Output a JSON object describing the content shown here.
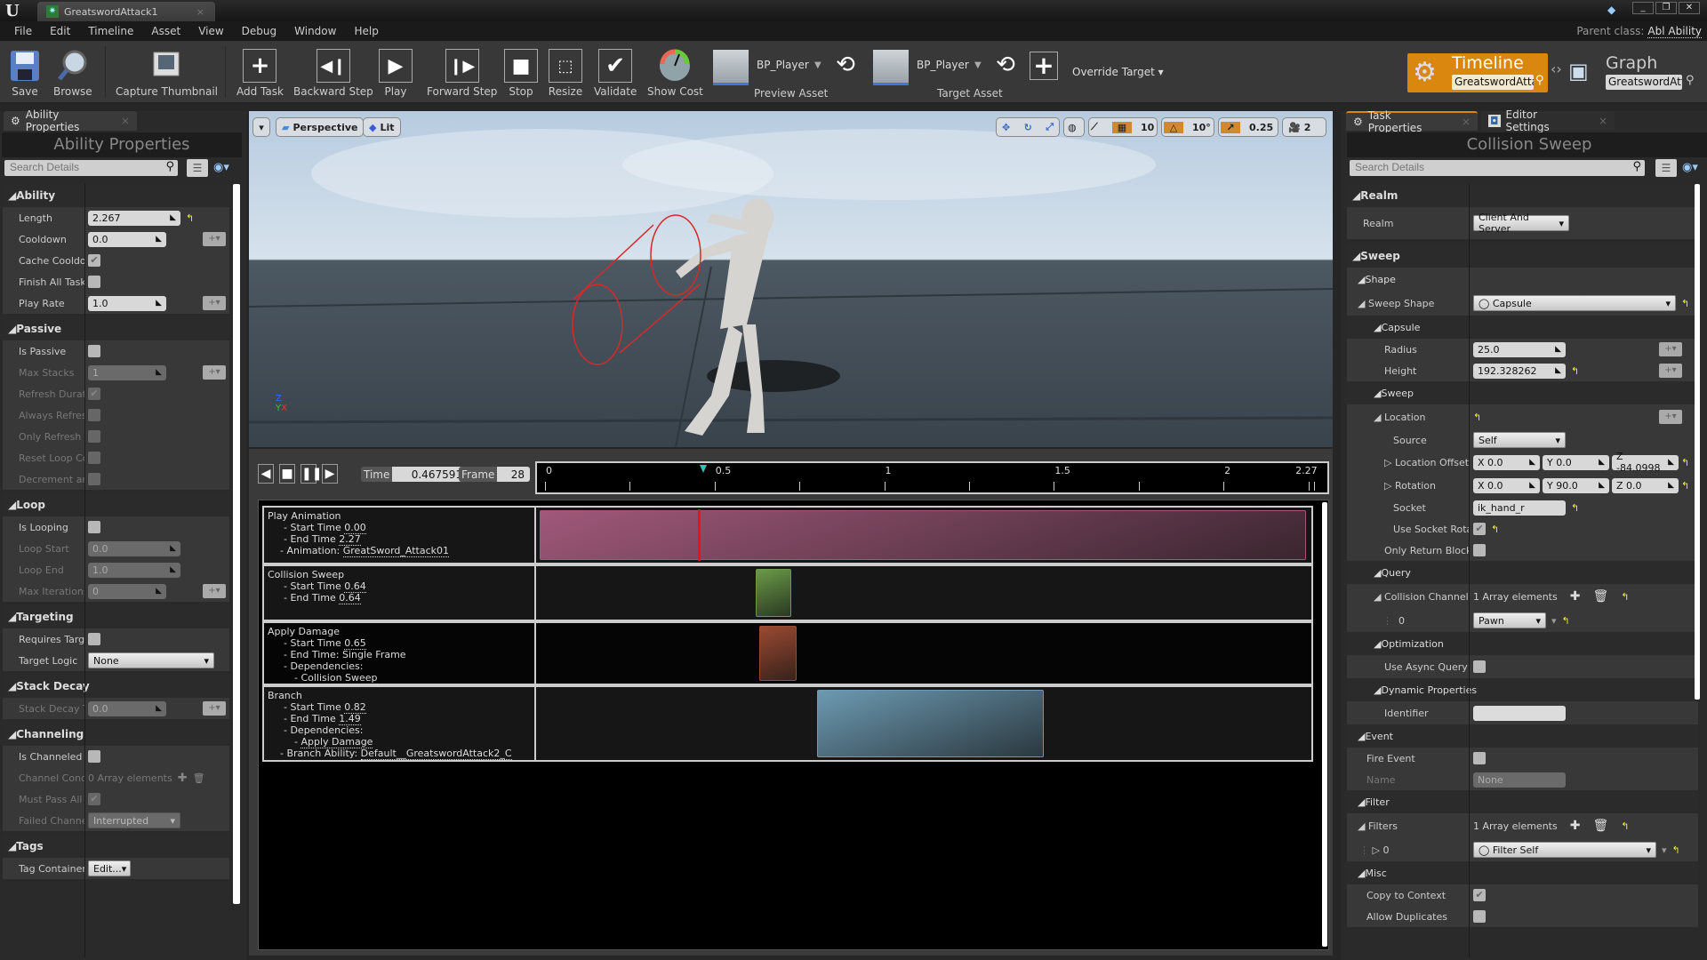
{
  "window": {
    "doc_tab": "GreatswordAttack1",
    "parent_class_label": "Parent class:",
    "parent_class_value": "Abl Ability",
    "controls": [
      "_",
      "❐",
      "✕"
    ]
  },
  "menu": [
    "File",
    "Edit",
    "Timeline",
    "Asset",
    "View",
    "Debug",
    "Window",
    "Help"
  ],
  "toolbar": {
    "save": "Save",
    "browse": "Browse",
    "capture_thumbnail": "Capture Thumbnail",
    "add_task": "Add Task",
    "backward_step": "Backward Step",
    "play": "Play",
    "forward_step": "Forward Step",
    "stop": "Stop",
    "resize": "Resize",
    "validate": "Validate",
    "show_cost": "Show Cost",
    "preview_asset_name": "BP_Player",
    "preview_asset_label": "Preview Asset",
    "target_asset_name": "BP_Player",
    "target_asset_label": "Target Asset",
    "override_target": "Override Target"
  },
  "modes": {
    "timeline": {
      "label": "Timeline",
      "field": "GreatswordAtta"
    },
    "graph": {
      "label": "Graph",
      "field": "GreatswordAtta"
    }
  },
  "left_panel": {
    "tab": "Ability Properties",
    "title": "Ability Properties",
    "search_placeholder": "Search Details",
    "sections": [
      {
        "name": "Ability",
        "rows": [
          {
            "label": "Length",
            "type": "num",
            "value": "2.267",
            "reset": true
          },
          {
            "label": "Cooldown",
            "type": "num",
            "value": "0.0",
            "plus": true
          },
          {
            "label": "Cache Cooldow",
            "type": "chk",
            "checked": true
          },
          {
            "label": "Finish All Task",
            "type": "chk",
            "checked": false
          },
          {
            "label": "Play Rate",
            "type": "num",
            "value": "1.0",
            "plus": true
          }
        ]
      },
      {
        "name": "Passive",
        "rows": [
          {
            "label": "Is Passive",
            "type": "chk",
            "checked": false
          },
          {
            "label": "Max Stacks",
            "type": "num",
            "value": "1",
            "plus": true,
            "disabled": true
          },
          {
            "label": "Refresh Durati",
            "type": "chk",
            "checked": true,
            "disabled": true
          },
          {
            "label": "Always Refres",
            "type": "chk",
            "checked": false,
            "disabled": true
          },
          {
            "label": "Only Refresh L",
            "type": "chk",
            "checked": false,
            "disabled": true
          },
          {
            "label": "Reset Loop Co",
            "type": "chk",
            "checked": false,
            "disabled": true
          },
          {
            "label": "Decrement an",
            "type": "chk",
            "checked": false,
            "disabled": true
          }
        ]
      },
      {
        "name": "Loop",
        "rows": [
          {
            "label": "Is Looping",
            "type": "chk",
            "checked": false
          },
          {
            "label": "Loop Start",
            "type": "num",
            "value": "0.0",
            "disabled": true
          },
          {
            "label": "Loop End",
            "type": "num",
            "value": "1.0",
            "disabled": true
          },
          {
            "label": "Max Iterations",
            "type": "num",
            "value": "0",
            "plus": true,
            "disabled": true
          }
        ]
      },
      {
        "name": "Targeting",
        "rows": [
          {
            "label": "Requires Targ",
            "type": "chk",
            "checked": false
          },
          {
            "label": "Target Logic",
            "type": "drop",
            "value": "None"
          }
        ]
      },
      {
        "name": "Stack Decay",
        "rows": [
          {
            "label": "Stack Decay T",
            "type": "num",
            "value": "0.0",
            "plus": true,
            "disabled": true
          }
        ]
      },
      {
        "name": "Channeling",
        "rows": [
          {
            "label": "Is Channeled",
            "type": "chk",
            "checked": false
          },
          {
            "label": "Channel Condi",
            "type": "array",
            "value": "0 Array elements",
            "disabled": true
          },
          {
            "label": "Must Pass All",
            "type": "chk",
            "checked": true,
            "disabled": true
          },
          {
            "label": "Failed Channel",
            "type": "drop",
            "value": "Interrupted",
            "disabled": true
          }
        ]
      },
      {
        "name": "Tags",
        "rows": [
          {
            "label": "Tag Container",
            "type": "edit",
            "value": "Edit..."
          }
        ]
      }
    ]
  },
  "viewport": {
    "view_mode": "Perspective",
    "lighting": "Lit",
    "grid_snap": "10",
    "rot_snap": "10°",
    "scale_snap": "0.25",
    "camera_speed": "2",
    "axis": {
      "z": "Z",
      "y": "Y",
      "x": "X"
    }
  },
  "sequencer": {
    "time_label": "Time",
    "time_value": "0.467591",
    "frame_label": "Frame",
    "frame_value": "28",
    "ruler_labels": [
      "0",
      "0.5",
      "1",
      "1.5",
      "2",
      "2.27"
    ],
    "ruler_max": 2.267,
    "playhead_time": 0.467591,
    "tracks": [
      {
        "name": "Play Animation",
        "lines": [
          {
            "text": "- Start Time ",
            "link": "0.00"
          },
          {
            "text": "- End Time ",
            "link": "2.27"
          },
          {
            "text": "- Animation: ",
            "link": "GreatSword_Attack01",
            "indent": 1
          }
        ],
        "start": 0.0,
        "end": 2.267,
        "color": "#a0587a"
      },
      {
        "name": "Collision Sweep",
        "lines": [
          {
            "text": "- Start Time ",
            "link": "0.64"
          },
          {
            "text": "- End Time ",
            "link": "0.64"
          }
        ],
        "start": 0.64,
        "end": 0.745,
        "color": "#6a9a48"
      },
      {
        "name": "Apply Damage",
        "lines": [
          {
            "text": "- Start Time ",
            "link": "0.65"
          },
          {
            "text": "- End Time: Single Frame",
            "link": ""
          },
          {
            "text": "- Dependencies:",
            "link": ""
          },
          {
            "text": "- ",
            "link": "Collision Sweep",
            "indent": 2
          }
        ],
        "start": 0.65,
        "end": 0.76,
        "color": "#9a4a32"
      },
      {
        "name": "Branch",
        "lines": [
          {
            "text": "- Start Time ",
            "link": "0.82"
          },
          {
            "text": "- End Time ",
            "link": "1.49"
          },
          {
            "text": "- Dependencies:",
            "link": ""
          },
          {
            "text": "- ",
            "link": "Apply Damage",
            "indent": 2
          },
          {
            "text": "- Branch Ability: ",
            "link": "Default__GreatswordAttack2_C",
            "indent": 1
          }
        ],
        "start": 0.82,
        "end": 1.49,
        "color": "#6c9ab2"
      }
    ]
  },
  "right_panel": {
    "tabs": [
      "Task Properties",
      "Editor Settings"
    ],
    "title": "Collision Sweep",
    "search_placeholder": "Search Details",
    "realm_section": "Realm",
    "realm_label": "Realm",
    "realm_value": "Client And Server",
    "sweep_section": "Sweep",
    "shape_label": "Shape",
    "sweep_shape_label": "Sweep Shape",
    "sweep_shape_value": "Capsule",
    "capsule_label": "Capsule",
    "radius_label": "Radius",
    "radius_value": "25.0",
    "height_label": "Height",
    "height_value": "192.328262",
    "sweep_sub_label": "Sweep",
    "location_label": "Location",
    "source_label": "Source",
    "source_value": "Self",
    "loc_offset_label": "Location Offset",
    "loc_offset": {
      "x": "0.0",
      "y": "0.0",
      "z": "-84.0998"
    },
    "rotation_label": "Rotation",
    "rotation": {
      "x": "0.0",
      "y": "90.0",
      "z": "0.0"
    },
    "socket_label": "Socket",
    "socket_value": "ik_hand_r",
    "use_socket_rot_label": "Use Socket Rota",
    "use_socket_rot": true,
    "only_return_block_label": "Only Return Block",
    "query_label": "Query",
    "collision_channels_label": "Collision Channels",
    "collision_channels_count": "1 Array elements",
    "channel_index": "0",
    "channel_value": "Pawn",
    "optimization_label": "Optimization",
    "use_async_label": "Use Async Query",
    "dynamic_label": "Dynamic Properties",
    "identifier_label": "Identifier",
    "identifier_value": "",
    "event_label": "Event",
    "fire_event_label": "Fire Event",
    "name_label": "Name",
    "name_value": "None",
    "filter_label": "Filter",
    "filters_label": "Filters",
    "filters_count": "1 Array elements",
    "filter_index": "0",
    "filter_value": "Filter Self",
    "misc_label": "Misc",
    "copy_context_label": "Copy to Context",
    "copy_context": true,
    "allow_dup_label": "Allow Duplicates"
  }
}
